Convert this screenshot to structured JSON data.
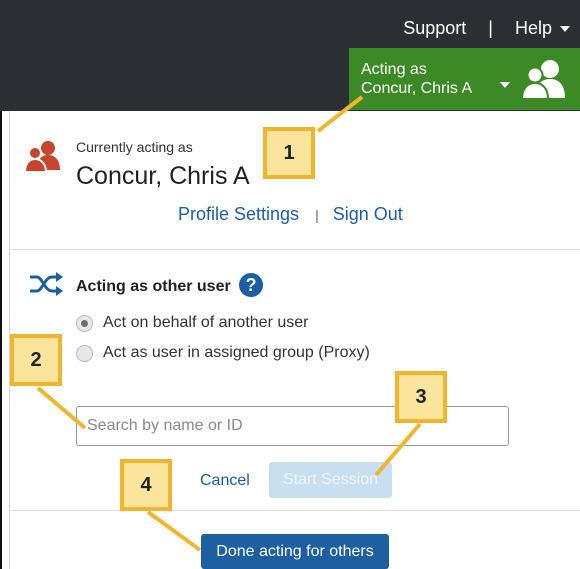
{
  "header": {
    "support_label": "Support",
    "separator": "|",
    "help_label": "Help",
    "acting_as": {
      "line1": "Acting as",
      "line2": "Concur, Chris A"
    }
  },
  "current_user": {
    "label": "Currently acting as",
    "name": "Concur, Chris A",
    "profile_settings_label": "Profile Settings",
    "separator": "|",
    "sign_out_label": "Sign Out"
  },
  "other_user": {
    "title": "Acting as other user",
    "help_glyph": "?",
    "options": [
      {
        "label": "Act on behalf of another user",
        "selected": true
      },
      {
        "label": "Act as user in assigned group (Proxy)",
        "selected": false
      }
    ],
    "search": {
      "placeholder": "Search by name or ID",
      "value": ""
    },
    "cancel_label": "Cancel",
    "start_session_label": "Start Session"
  },
  "footer": {
    "done_label": "Done acting for others"
  },
  "callouts": [
    "1",
    "2",
    "3",
    "4"
  ],
  "icons": {
    "users_icon": "users-icon",
    "shuffle_icon": "shuffle-icon",
    "help_icon": "help-icon"
  },
  "colors": {
    "header_bg": "#2b2e33",
    "acting_green": "#3b8a25",
    "link_blue": "#1a5fa5",
    "primary_button": "#1d5fa0",
    "disabled_button": "#c8dff2",
    "user_icon_red": "#c8452b",
    "callout_fill": "#fbe49b",
    "callout_border": "#f1b52d"
  }
}
